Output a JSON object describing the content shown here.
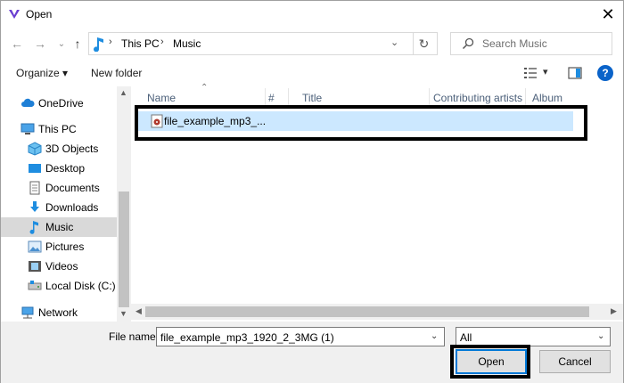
{
  "window": {
    "title": "Open",
    "close_glyph": "✕"
  },
  "nav": {
    "back_glyph": "←",
    "forward_glyph": "→",
    "recent_glyph": "⌄",
    "up_glyph": "↑",
    "breadcrumbs": [
      "This PC",
      "Music"
    ],
    "crumb_separator": "›",
    "address_dropdown_glyph": "⌄",
    "refresh_glyph": "↻",
    "search_placeholder": "Search Music"
  },
  "toolbar": {
    "organize_label": "Organize ▾",
    "new_folder_label": "New folder",
    "view_glyph": "▾",
    "help_glyph": "?"
  },
  "sidebar": {
    "items": [
      {
        "label": "OneDrive",
        "icon": "cloud-icon"
      },
      {
        "label": "This PC",
        "icon": "computer-icon"
      },
      {
        "label": "3D Objects",
        "icon": "cube-icon"
      },
      {
        "label": "Desktop",
        "icon": "desktop-icon"
      },
      {
        "label": "Documents",
        "icon": "documents-icon"
      },
      {
        "label": "Downloads",
        "icon": "downloads-icon"
      },
      {
        "label": "Music",
        "icon": "music-icon"
      },
      {
        "label": "Pictures",
        "icon": "pictures-icon"
      },
      {
        "label": "Videos",
        "icon": "videos-icon"
      },
      {
        "label": "Local Disk (C:)",
        "icon": "disk-icon"
      },
      {
        "label": "Network",
        "icon": "network-icon"
      }
    ],
    "selected": "Music"
  },
  "columns": [
    "Name",
    "#",
    "Title",
    "Contributing artists",
    "Album"
  ],
  "files": [
    {
      "name": "file_example_mp3_..."
    }
  ],
  "bottom": {
    "file_name_label": "File name:",
    "file_name_value": "file_example_mp3_1920_2_3MG (1)",
    "file_type_value": "All",
    "open_label": "Open",
    "cancel_label": "Cancel"
  },
  "colors": {
    "accent": "#0078d7",
    "selection": "#cce8ff",
    "highlight_border": "#000000"
  }
}
